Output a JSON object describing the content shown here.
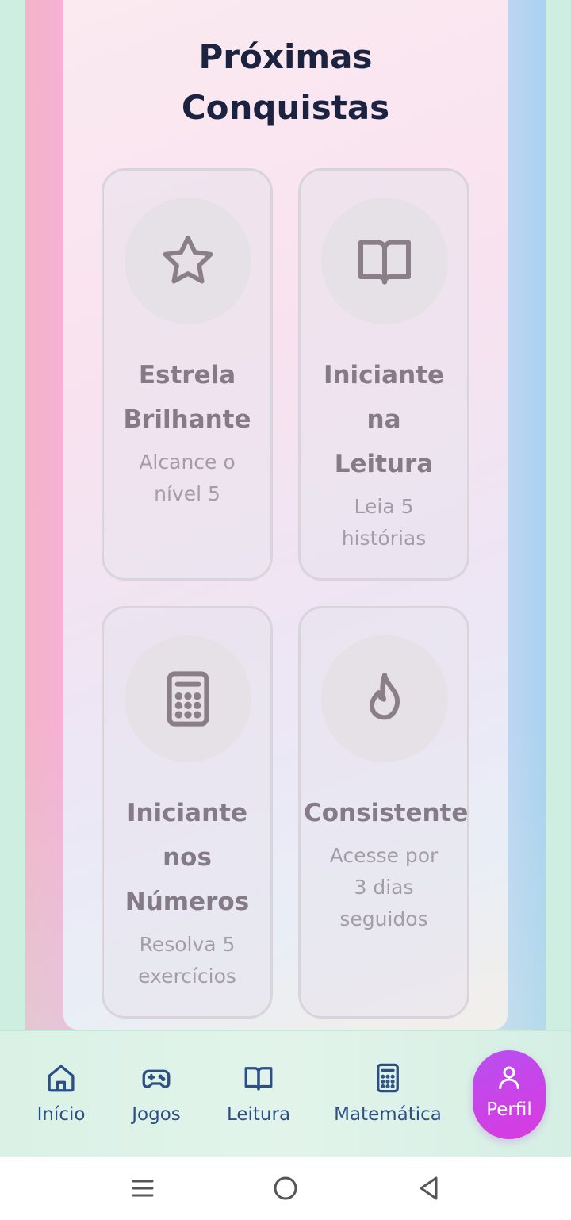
{
  "section": {
    "title_line1": "Próximas",
    "title_line2": "Conquistas"
  },
  "achievements": [
    {
      "icon": "star-icon",
      "title_lines": [
        "Estrela",
        "Brilhante"
      ],
      "desc_lines": [
        "Alcance o",
        "nível 5"
      ]
    },
    {
      "icon": "book-open-icon",
      "title_lines": [
        "Iniciante",
        "na",
        "Leitura"
      ],
      "desc_lines": [
        "Leia 5",
        "histórias"
      ]
    },
    {
      "icon": "calculator-icon",
      "title_lines": [
        "Iniciante",
        "nos",
        "Números"
      ],
      "desc_lines": [
        "Resolva 5",
        "exercícios"
      ]
    },
    {
      "icon": "flame-icon",
      "title_lines": [
        "Consistente"
      ],
      "desc_lines": [
        "Acesse por",
        "3 dias",
        "seguidos"
      ]
    }
  ],
  "bottom_nav": {
    "items": [
      {
        "label": "Início",
        "icon": "home-icon"
      },
      {
        "label": "Jogos",
        "icon": "gamepad-icon"
      },
      {
        "label": "Leitura",
        "icon": "book-open-icon"
      },
      {
        "label": "Matemática",
        "icon": "calculator-icon"
      },
      {
        "label": "Perfil",
        "icon": "user-icon",
        "active": true
      }
    ]
  },
  "colors": {
    "title": "#1c2340",
    "nav_text": "#2d4f86",
    "active_pill": "#c845e8",
    "locked_text": "#857b86"
  }
}
